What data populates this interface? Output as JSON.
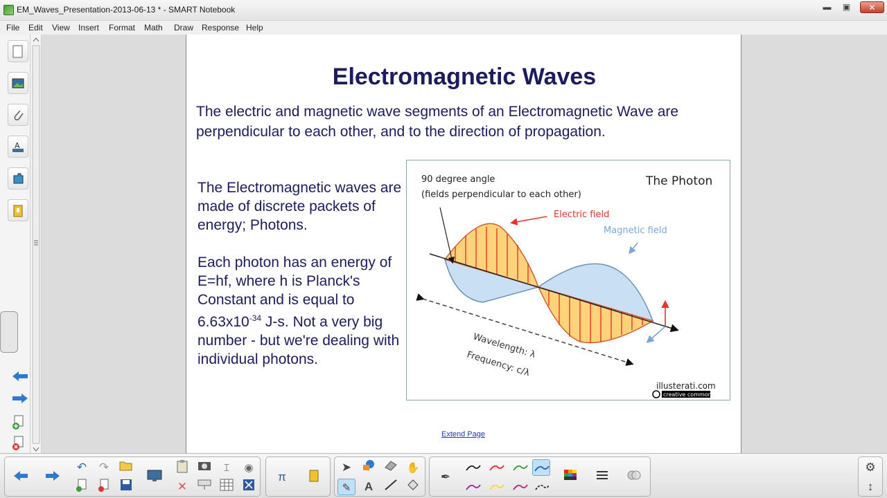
{
  "window": {
    "title": "EM_Waves_Presentation-2013-06-13 * - SMART Notebook",
    "min": "▬",
    "max": "▣",
    "close": "✕"
  },
  "menu": [
    "File",
    "Edit",
    "View",
    "Insert",
    "Format",
    "Math",
    "Draw",
    "Response",
    "Help"
  ],
  "page": {
    "title": "Electromagnetic Waves",
    "intro": "The electric and magnetic wave segments of an Electromagnetic Wave are perpendicular to each other, and to the direction of propagation.",
    "para1": "The Electromagnetic waves are made of discrete packets of energy; Photons.",
    "para2_a": "Each photon has an energy of E=hf, where h is Planck's Constant and is equal to 6.63x10",
    "para2_exp": "-34",
    "para2_b": " J-s.  Not a very big number - but we're dealing with individual photons.",
    "extend": "Extend Page"
  },
  "figure": {
    "angle_line1": "90 degree angle",
    "angle_line2": "(fields perpendicular to each other)",
    "title": "The Photon",
    "electric": "Electric field",
    "magnetic": "Magnetic field",
    "wavelength": "Wavelength: λ",
    "frequency": "Frequency: c/λ",
    "credit": "illusterati.com",
    "cc": "creative commons",
    "colors": {
      "electric": "#e8322a",
      "magnetic": "#7aa7d4",
      "fill_e": "#ffd37a",
      "fill_m": "#c9dff2"
    }
  },
  "sidebar": {
    "icons": [
      "page-sorter-icon",
      "gallery-icon",
      "attachments-icon",
      "properties-icon",
      "addons-icon",
      "lesson-activity-icon"
    ]
  },
  "toolbar": {
    "active_pen": "blue-pen"
  }
}
